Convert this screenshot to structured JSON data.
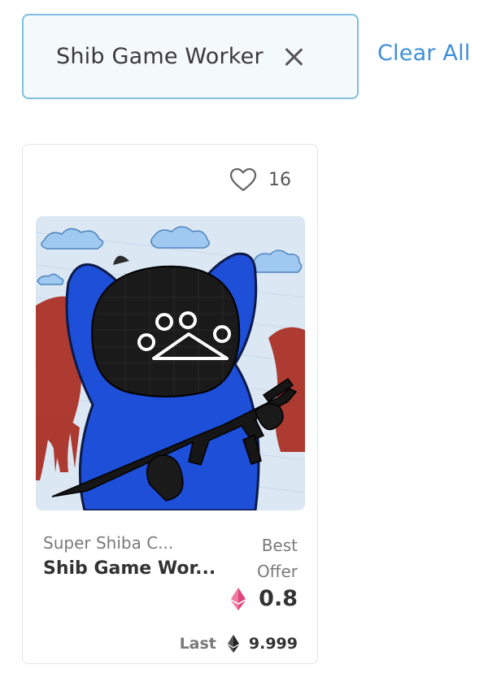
{
  "filter": {
    "chip_label": "Shib Game Worker",
    "clear_all_label": "Clear All"
  },
  "card": {
    "favorites_count": "16",
    "collection_name": "Super Shiba C...",
    "item_name": "Shib Game Wor...",
    "offer_label_line1": "Best",
    "offer_label_line2": "Offer",
    "price": "0.8",
    "last_label": "Last",
    "last_price": "9.999",
    "price_icon": "eth-pink-icon",
    "last_price_icon": "eth-black-icon"
  },
  "colors": {
    "accent": "#3f8fd8",
    "chip_border": "#7fbfe0",
    "chip_bg": "#f4f9fc",
    "eth_pink": "#e0467c"
  }
}
